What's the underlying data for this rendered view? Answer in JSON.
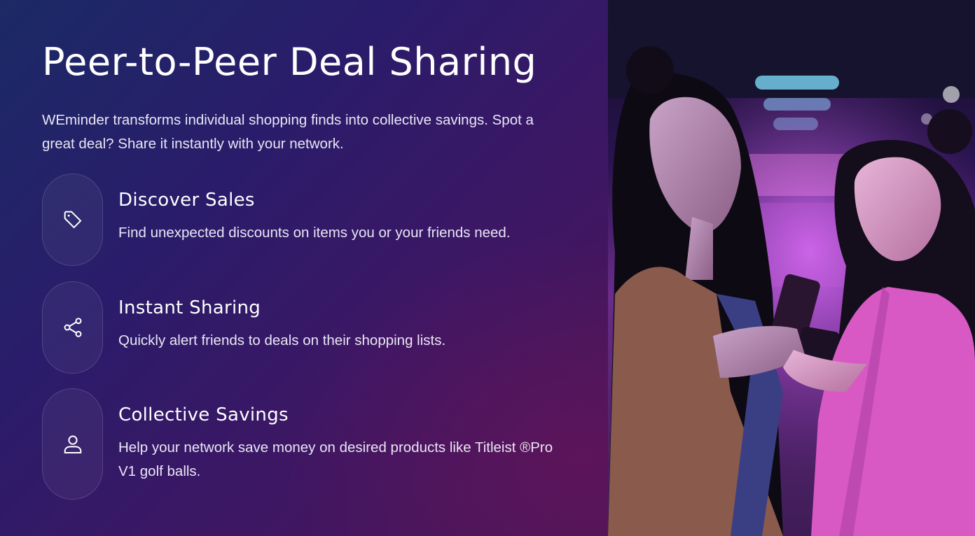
{
  "page": {
    "title": "Peer-to-Peer Deal Sharing",
    "intro": "WEminder transforms individual shopping finds into collective savings. Spot a great deal? Share it instantly with your network."
  },
  "features": [
    {
      "icon": "tag-icon",
      "title": "Discover Sales",
      "description": "Find unexpected discounts on items you or your friends need."
    },
    {
      "icon": "share-icon",
      "title": "Instant Sharing",
      "description": "Quickly alert friends to deals on their shopping lists."
    },
    {
      "icon": "user-icon",
      "title": "Collective Savings",
      "description": "Help your network save money on desired products like Titleist ®Pro V1 golf balls."
    }
  ],
  "photo": {
    "subject": "two-women-looking-at-phone"
  },
  "colors": {
    "bg_start": "#1b2a66",
    "bg_end": "#4a1556",
    "text": "#ffffff",
    "muted_text": "#e9e6f5"
  }
}
